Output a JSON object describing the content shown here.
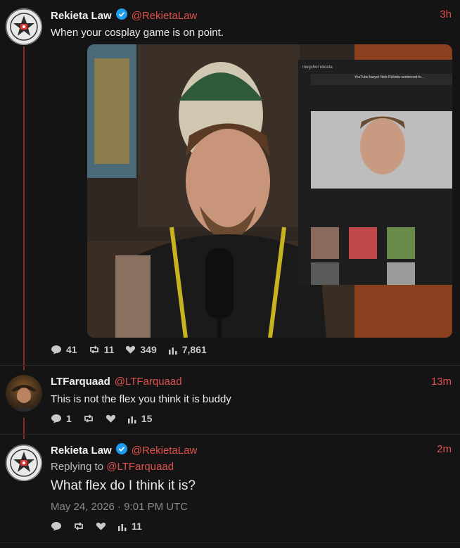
{
  "post1": {
    "name": "Rekieta Law",
    "handle": "@RekietaLaw",
    "time": "3h",
    "text": "When your cosplay game is on point.",
    "stats": {
      "replies": "41",
      "reposts": "11",
      "likes": "349",
      "views": "7,861"
    },
    "media_overlay": {
      "search_hint": "mugshot rekieta",
      "title": "YouTube lawyer Nick Rekieta sentenced fo..."
    }
  },
  "post2": {
    "name": "LTFarquaad",
    "handle": "@LTFarquaad",
    "time": "13m",
    "text": "This is not the flex you think it is buddy",
    "stats": {
      "replies": "1",
      "views": "15"
    }
  },
  "post3": {
    "name": "Rekieta Law",
    "handle": "@RekietaLaw",
    "time": "2m",
    "replying_prefix": "Replying to",
    "replying_to": "@LTFarquaad",
    "text": "What flex do I think it is?",
    "date": "May 24, 2026 · 9:01 PM UTC",
    "stats": {
      "views": "11"
    }
  },
  "colors": {
    "accent": "#e0504d",
    "verified": "#1d9bf0",
    "background": "#141414"
  }
}
